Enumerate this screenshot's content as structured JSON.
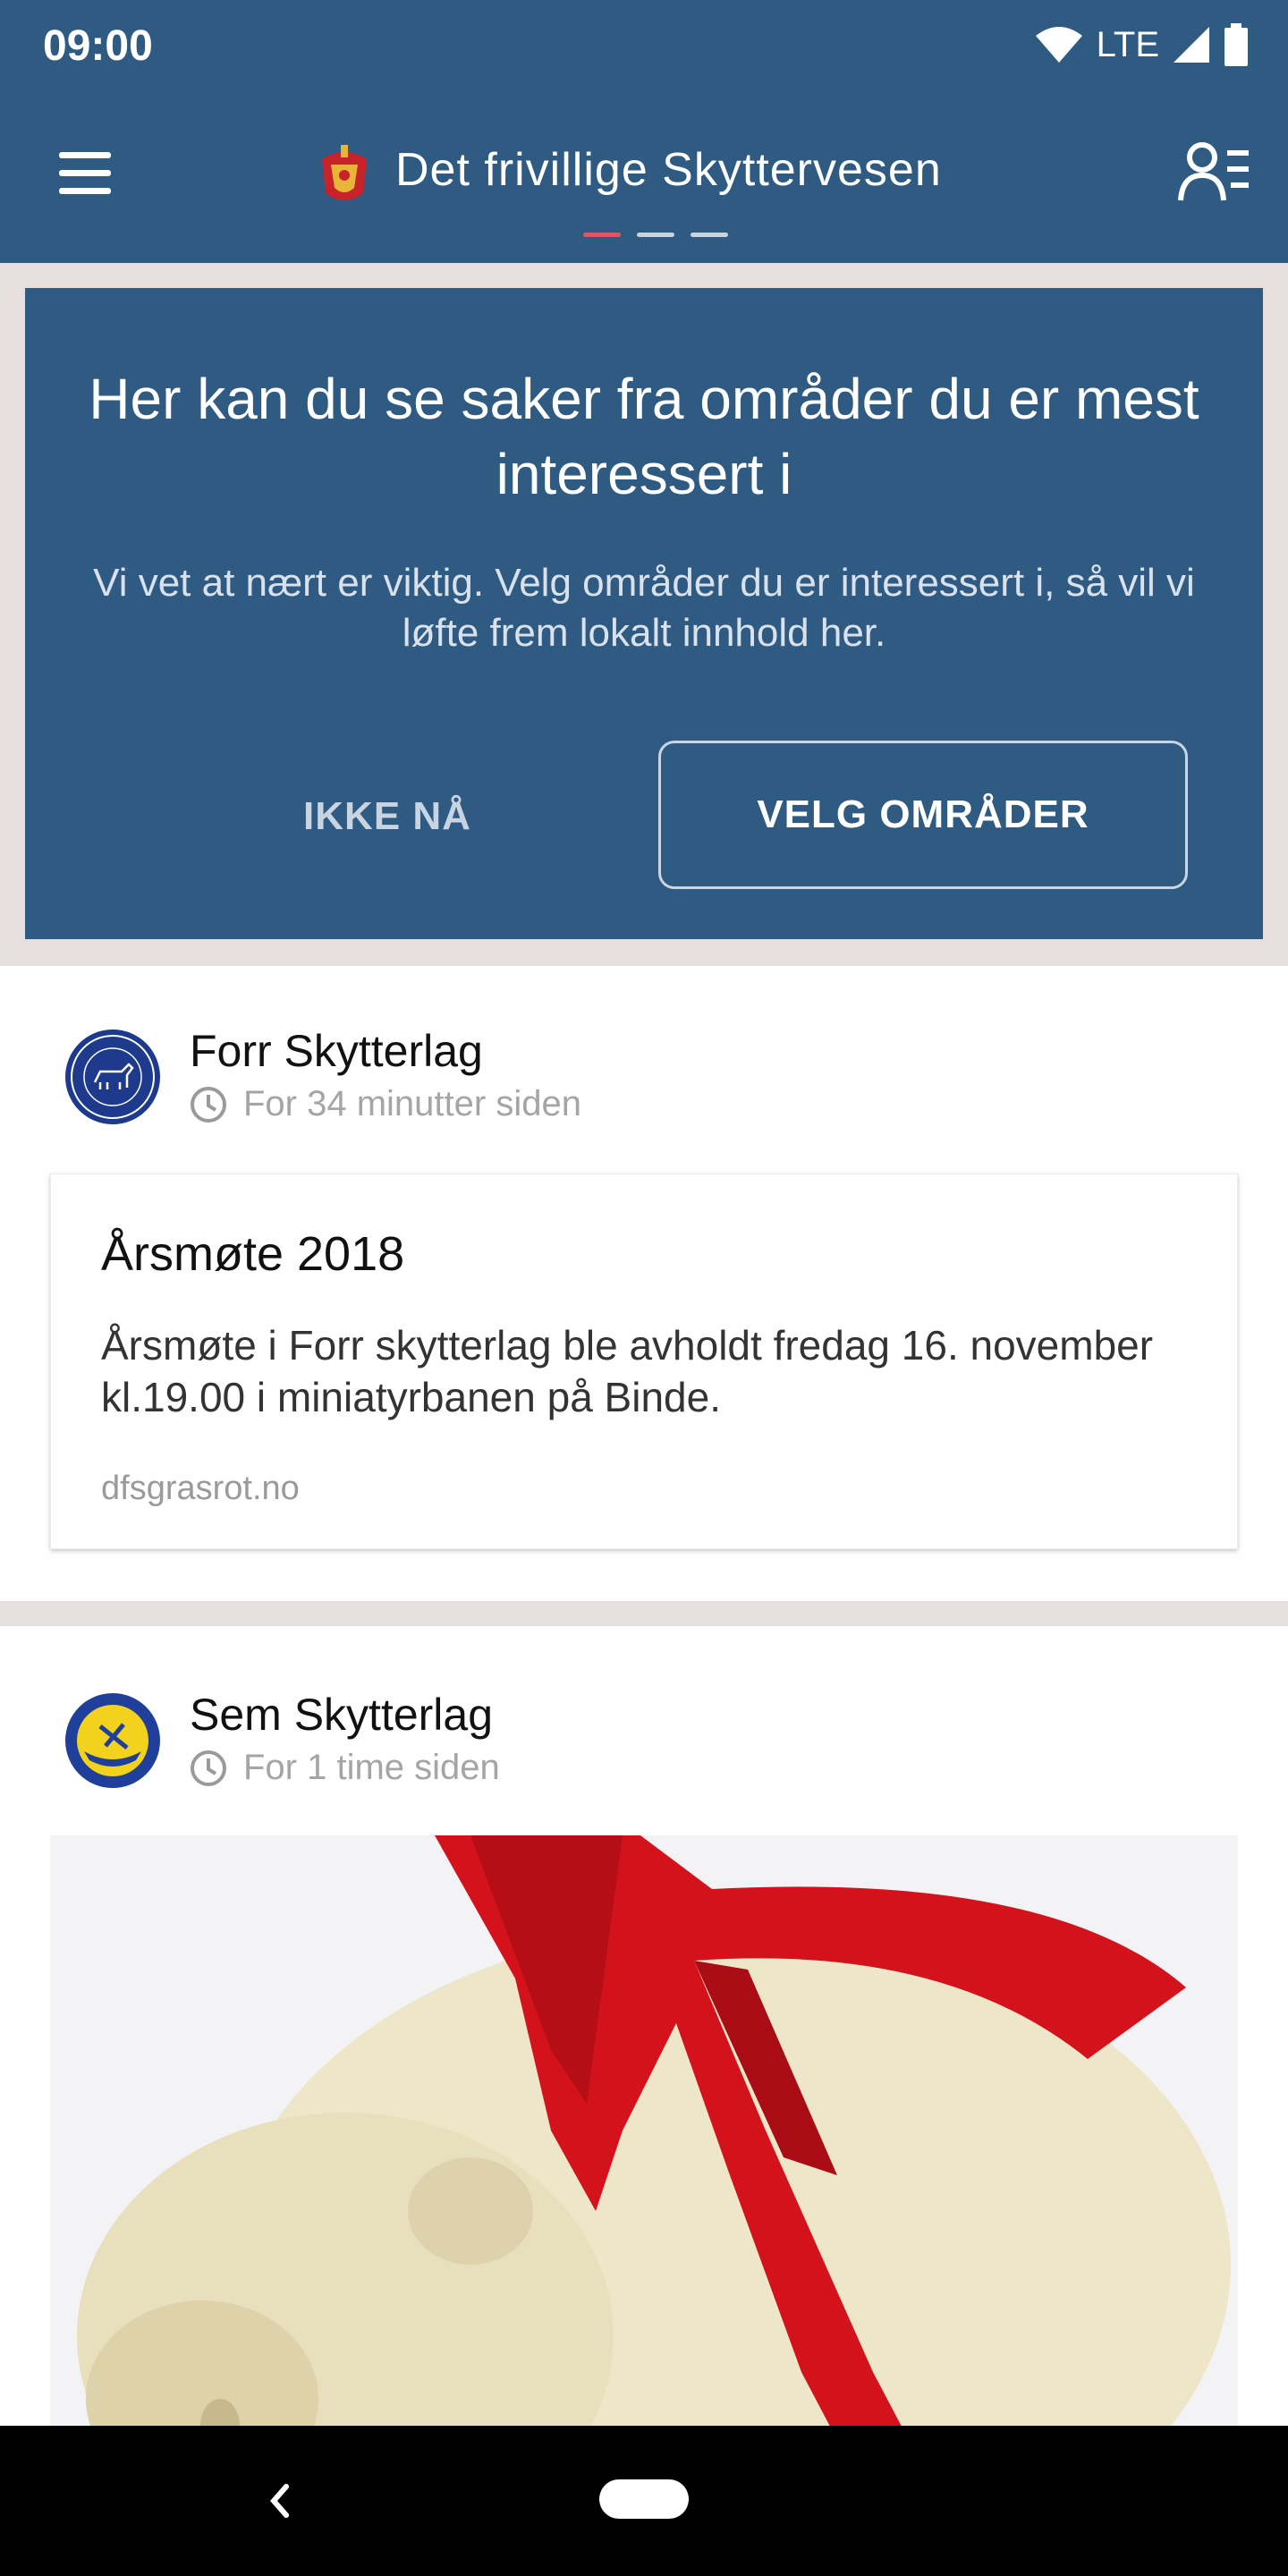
{
  "status_bar": {
    "time": "09:00",
    "network": "LTE",
    "icons": [
      "wifi-icon",
      "signal-icon",
      "battery-icon"
    ]
  },
  "app_bar": {
    "title": "Det frivillige Skyttervesen",
    "menu_icon": "menu-icon",
    "profile_icon": "profile-list-icon",
    "pager_count": 3,
    "pager_active_index": 0
  },
  "promo": {
    "title": "Her kan du se saker fra områder du er mest interessert i",
    "body": "Vi vet at nært er viktig. Velg områder du er interessert i, så vil vi løfte frem lokalt innhold her.",
    "skip_label": "IKKE NÅ",
    "choose_label": "VELG OMRÅDER"
  },
  "feed": [
    {
      "author": "Forr Skytterlag",
      "time": "For 34 minutter siden",
      "card": {
        "title": "Årsmøte 2018",
        "text": "Årsmøte i Forr skytterlag ble avholdt fredag 16. november kl.19.00 i miniatyrbanen på Binde.",
        "source": "dfsgrasrot.no"
      }
    },
    {
      "author": "Sem Skytterlag",
      "time": "For 1 time siden",
      "image": "marzipan-pig-with-red-ribbon"
    }
  ],
  "colors": {
    "primary": "#2f5a82",
    "accent": "#e0565f",
    "background": "#e6dfdd",
    "ribbon": "#d3121c"
  }
}
